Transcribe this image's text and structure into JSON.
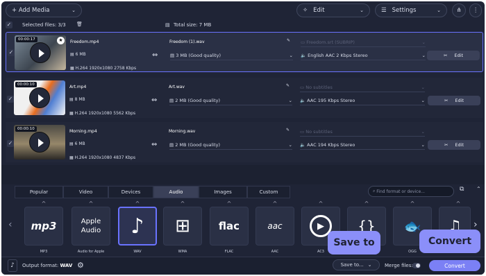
{
  "toolbar": {
    "add_media": "+ Add Media",
    "edit": "Edit",
    "settings": "Settings"
  },
  "summary": {
    "selected": "Selected files: 3/3",
    "total": "Total size: 7 MB"
  },
  "files": [
    {
      "duration": "00:00:17",
      "name": "Freedom.mp4",
      "size": "6 MB",
      "codec": "H.264 1920x1080 2758 Kbps",
      "output_name": "Freedom (1).wav",
      "quality": "3 MB (Good quality)",
      "subtitles": "Freedom.srt (SUBRIP)",
      "audio": "English AAC 2 Kbps Stereo",
      "edit": "Edit"
    },
    {
      "duration": "00:00:10",
      "name": "Art.mp4",
      "size": "8 MB",
      "codec": "H.264 1920x1080 5562 Kbps",
      "output_name": "Art.wav",
      "quality": "2 MB (Good quality)",
      "subtitles": "No subtitles",
      "audio": "AAC 195 Kbps Stereo",
      "edit": "Edit"
    },
    {
      "duration": "00:00:10",
      "name": "Morning.mp4",
      "size": "6 MB",
      "codec": "H.264 1920x1080 4837 Kbps",
      "output_name": "Morning.wav",
      "quality": "2 MB (Good quality)",
      "subtitles": "No subtitles",
      "audio": "AAC 194 Kbps Stereo",
      "edit": "Edit"
    }
  ],
  "tabs": [
    "Popular",
    "Video",
    "Devices",
    "Audio",
    "Images",
    "Custom"
  ],
  "search_placeholder": "Find format or device...",
  "formats": [
    {
      "label": "MP3",
      "logo": "mp3"
    },
    {
      "label": "Audio for Apple",
      "logo": "Apple Audio"
    },
    {
      "label": "WAV",
      "logo": "♪"
    },
    {
      "label": "WMA",
      "logo": "⊞"
    },
    {
      "label": "FLAC",
      "logo": "flac"
    },
    {
      "label": "AAC",
      "logo": "aac"
    },
    {
      "label": "AC3",
      "logo": "▶"
    },
    {
      "label": "",
      "logo": "{}"
    },
    {
      "label": "OGG",
      "logo": "🐟"
    },
    {
      "label": "",
      "logo": "♫"
    }
  ],
  "bottom": {
    "output_format_label": "Output format:",
    "output_format_value": "WAV",
    "save_to": "Save to...",
    "merge": "Merge files:",
    "convert": "Convert"
  },
  "callouts": {
    "save_to": "Save to",
    "convert": "Convert"
  }
}
